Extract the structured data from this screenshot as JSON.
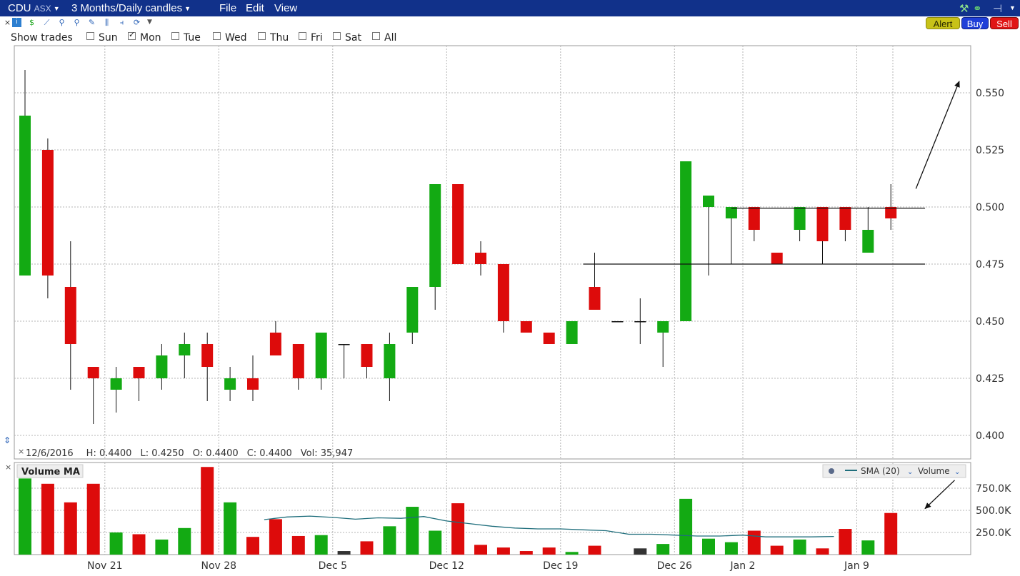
{
  "titlebar": {
    "symbol": "CDU",
    "exchange": "ASX",
    "period": "3 Months/Daily candles",
    "menus": [
      "File",
      "Edit",
      "View"
    ]
  },
  "buttons": {
    "alert": "Alert",
    "buy": "Buy",
    "sell": "Sell"
  },
  "show_trades": {
    "label": "Show trades",
    "days": [
      {
        "label": "Sun",
        "checked": false
      },
      {
        "label": "Mon",
        "checked": true
      },
      {
        "label": "Tue",
        "checked": false
      },
      {
        "label": "Wed",
        "checked": false
      },
      {
        "label": "Thu",
        "checked": false
      },
      {
        "label": "Fri",
        "checked": false
      },
      {
        "label": "Sat",
        "checked": false
      },
      {
        "label": "All",
        "checked": false
      }
    ]
  },
  "info_line": {
    "date": "12/6/2016",
    "high": "H: 0.4400",
    "low": "L: 0.4250",
    "open": "O: 0.4400",
    "close": "C: 0.4400",
    "volume": "Vol: 35,947"
  },
  "volume_panel": {
    "title": "Volume MA",
    "legend_sma": "SMA (20)",
    "legend_volume": "Volume"
  },
  "colors": {
    "up": "#13aa13",
    "down": "#dd0b0b",
    "neutral": "#333333",
    "sma": "#1f6e7c",
    "titlebar": "#11318a"
  },
  "chart_data": [
    {
      "type": "candlestick",
      "ylim": [
        0.4,
        0.56
      ],
      "yticks": [
        "0.400",
        "0.425",
        "0.450",
        "0.475",
        "0.500",
        "0.525",
        "0.550"
      ],
      "xticks": [
        {
          "label": "Nov 21",
          "index": 2
        },
        {
          "label": "Nov 28",
          "index": 7
        },
        {
          "label": "Dec 5",
          "index": 12
        },
        {
          "label": "Dec 12",
          "index": 17
        },
        {
          "label": "Dec 19",
          "index": 22
        },
        {
          "label": "Dec 26",
          "index": 27
        },
        {
          "label": "Jan 2",
          "index": 30
        },
        {
          "label": "Jan 9",
          "index": 35
        }
      ],
      "candles": [
        {
          "o": 0.47,
          "h": 0.56,
          "l": 0.47,
          "c": 0.54
        },
        {
          "o": 0.525,
          "h": 0.53,
          "l": 0.46,
          "c": 0.47
        },
        {
          "o": 0.465,
          "h": 0.485,
          "l": 0.42,
          "c": 0.44
        },
        {
          "o": 0.43,
          "h": 0.43,
          "l": 0.405,
          "c": 0.425
        },
        {
          "o": 0.42,
          "h": 0.43,
          "l": 0.41,
          "c": 0.425
        },
        {
          "o": 0.43,
          "h": 0.43,
          "l": 0.415,
          "c": 0.425
        },
        {
          "o": 0.425,
          "h": 0.44,
          "l": 0.42,
          "c": 0.435
        },
        {
          "o": 0.435,
          "h": 0.445,
          "l": 0.425,
          "c": 0.44
        },
        {
          "o": 0.44,
          "h": 0.445,
          "l": 0.415,
          "c": 0.43
        },
        {
          "o": 0.42,
          "h": 0.43,
          "l": 0.415,
          "c": 0.425
        },
        {
          "o": 0.425,
          "h": 0.435,
          "l": 0.415,
          "c": 0.42
        },
        {
          "o": 0.445,
          "h": 0.45,
          "l": 0.435,
          "c": 0.435
        },
        {
          "o": 0.44,
          "h": 0.44,
          "l": 0.42,
          "c": 0.425
        },
        {
          "o": 0.425,
          "h": 0.445,
          "l": 0.42,
          "c": 0.445
        },
        {
          "o": 0.44,
          "h": 0.44,
          "l": 0.425,
          "c": 0.44
        },
        {
          "o": 0.44,
          "h": 0.44,
          "l": 0.425,
          "c": 0.43
        },
        {
          "o": 0.425,
          "h": 0.445,
          "l": 0.415,
          "c": 0.44
        },
        {
          "o": 0.445,
          "h": 0.465,
          "l": 0.44,
          "c": 0.465
        },
        {
          "o": 0.465,
          "h": 0.51,
          "l": 0.455,
          "c": 0.51
        },
        {
          "o": 0.51,
          "h": 0.51,
          "l": 0.475,
          "c": 0.475
        },
        {
          "o": 0.48,
          "h": 0.485,
          "l": 0.47,
          "c": 0.475
        },
        {
          "o": 0.475,
          "h": 0.475,
          "l": 0.445,
          "c": 0.45
        },
        {
          "o": 0.45,
          "h": 0.45,
          "l": 0.445,
          "c": 0.445
        },
        {
          "o": 0.445,
          "h": 0.445,
          "l": 0.44,
          "c": 0.44
        },
        {
          "o": 0.44,
          "h": 0.45,
          "l": 0.44,
          "c": 0.45
        },
        {
          "o": 0.465,
          "h": 0.48,
          "l": 0.455,
          "c": 0.455
        },
        {
          "o": 0.45,
          "h": 0.45,
          "l": 0.45,
          "c": 0.45
        },
        {
          "o": 0.45,
          "h": 0.46,
          "l": 0.44,
          "c": 0.45
        },
        {
          "o": 0.445,
          "h": 0.45,
          "l": 0.43,
          "c": 0.45
        },
        {
          "o": 0.45,
          "h": 0.52,
          "l": 0.45,
          "c": 0.52
        },
        {
          "o": 0.5,
          "h": 0.505,
          "l": 0.47,
          "c": 0.505
        },
        {
          "o": 0.495,
          "h": 0.5,
          "l": 0.475,
          "c": 0.5
        },
        {
          "o": 0.5,
          "h": 0.5,
          "l": 0.485,
          "c": 0.49
        },
        {
          "o": 0.48,
          "h": 0.48,
          "l": 0.475,
          "c": 0.475
        },
        {
          "o": 0.49,
          "h": 0.5,
          "l": 0.485,
          "c": 0.5
        },
        {
          "o": 0.5,
          "h": 0.5,
          "l": 0.475,
          "c": 0.485
        },
        {
          "o": 0.5,
          "h": 0.5,
          "l": 0.485,
          "c": 0.49
        },
        {
          "o": 0.48,
          "h": 0.5,
          "l": 0.48,
          "c": 0.49
        },
        {
          "o": 0.5,
          "h": 0.51,
          "l": 0.49,
          "c": 0.495
        }
      ],
      "trendlines": [
        {
          "from_index": 24.5,
          "to_index": 39.5,
          "y": 0.475
        },
        {
          "from_index": 31,
          "to_index": 39.5,
          "y": 0.4995
        }
      ],
      "annotation": {
        "type": "arrow",
        "from": {
          "index": 39.1,
          "y": 0.508
        },
        "to": {
          "index": 41,
          "y": 0.555
        }
      }
    },
    {
      "type": "bar",
      "title": "Volume MA",
      "ylim": [
        0,
        950000
      ],
      "yticks": [
        "250.0K",
        "500.0K",
        "750.0K"
      ],
      "values": [
        860000,
        800000,
        590000,
        800000,
        250000,
        230000,
        170000,
        300000,
        990000,
        590000,
        200000,
        400000,
        210000,
        220000,
        40000,
        150000,
        320000,
        540000,
        270000,
        580000,
        110000,
        80000,
        40000,
        80000,
        30000,
        100000,
        0,
        70000,
        120000,
        630000,
        180000,
        140000,
        270000,
        100000,
        170000,
        70000,
        290000,
        160000,
        470000
      ],
      "colors": [
        "up",
        "down",
        "down",
        "down",
        "up",
        "down",
        "up",
        "up",
        "down",
        "up",
        "down",
        "down",
        "down",
        "up",
        "neutral",
        "down",
        "up",
        "up",
        "up",
        "down",
        "down",
        "down",
        "down",
        "down",
        "up",
        "down",
        "neutral",
        "neutral",
        "up",
        "up",
        "up",
        "up",
        "down",
        "down",
        "up",
        "down",
        "down",
        "up",
        "down"
      ],
      "sma": {
        "name": "SMA (20)",
        "start_index": 10.5,
        "values": [
          395000,
          425000,
          435000,
          420000,
          400000,
          415000,
          410000,
          430000,
          380000,
          350000,
          320000,
          300000,
          290000,
          290000,
          280000,
          270000,
          230000,
          230000,
          220000,
          210000,
          210000,
          220000,
          200000,
          200000,
          200000,
          205000
        ]
      },
      "annotation": {
        "type": "arrow",
        "from": {
          "index": 40.8,
          "y": 840000
        },
        "to": {
          "index": 39.5,
          "y": 520000
        }
      }
    }
  ]
}
